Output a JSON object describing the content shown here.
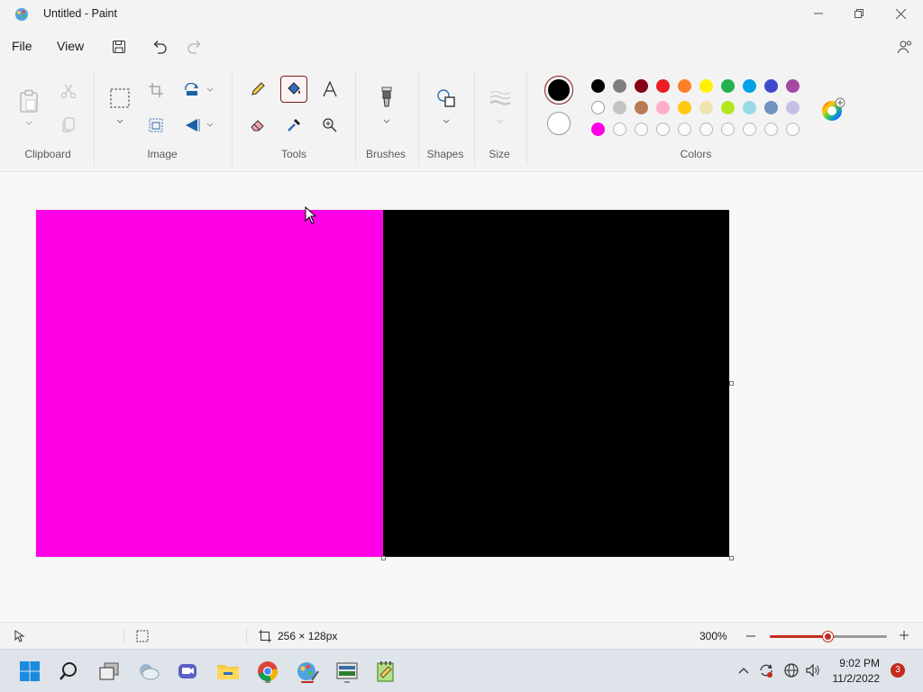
{
  "window": {
    "title": "Untitled - Paint"
  },
  "menu": {
    "file": "File",
    "view": "View"
  },
  "ribbon": {
    "groups": {
      "clipboard": "Clipboard",
      "image": "Image",
      "tools": "Tools",
      "brushes": "Brushes",
      "shapes": "Shapes",
      "size": "Size",
      "colors": "Colors"
    },
    "primary_color": "#000000",
    "secondary_color": "#ffffff",
    "palette_row1": [
      "#000000",
      "#7f7f7f",
      "#880015",
      "#ed1c24",
      "#ff7f27",
      "#fff200",
      "#22b14c",
      "#00a2e8",
      "#3f48cc",
      "#a349a4"
    ],
    "palette_row2": [
      "#ffffff",
      "#c3c3c3",
      "#b97a57",
      "#ffaec9",
      "#ffc90e",
      "#efe4b0",
      "#b5e61d",
      "#99d9ea",
      "#7092be",
      "#c8bfe7"
    ],
    "palette_row3": [
      "#ff00e6",
      "",
      "",
      "",
      "",
      "",
      "",
      "",
      "",
      ""
    ]
  },
  "canvas": {
    "left_color": "#ff00e6",
    "right_color": "#000000"
  },
  "status": {
    "canvas_size": "256 × 128px",
    "zoom": "300%",
    "zoom_level": 0.5
  },
  "taskbar": {
    "time": "9:02 PM",
    "date": "11/2/2022",
    "notifications": "3"
  },
  "accent": "#c42b1c"
}
